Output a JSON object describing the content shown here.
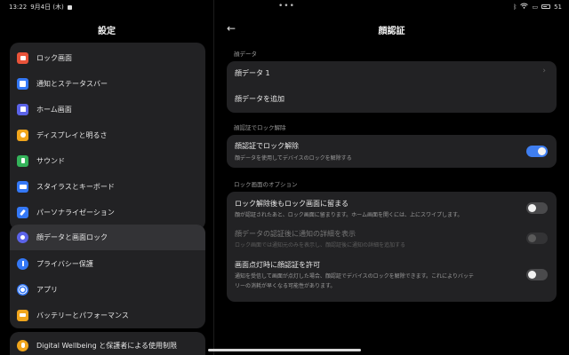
{
  "status_bar": {
    "time": "13:22",
    "date": "9月4日 (木)",
    "battery": "51"
  },
  "left_panel": {
    "title": "設定",
    "group1": [
      {
        "label": "ロック画面",
        "icon": "lock-icon",
        "color": "#e8533a"
      },
      {
        "label": "通知とステータスバー",
        "icon": "notification-icon",
        "color": "#3478f6"
      },
      {
        "label": "ホーム画面",
        "icon": "home-icon",
        "color": "#5b63e8"
      },
      {
        "label": "ディスプレイと明るさ",
        "icon": "brightness-icon",
        "color": "#f0a51c"
      },
      {
        "label": "サウンド",
        "icon": "sound-icon",
        "color": "#34b35a"
      },
      {
        "label": "スタイラスとキーボード",
        "icon": "keyboard-icon",
        "color": "#3478f6"
      },
      {
        "label": "パーソナライゼーション",
        "icon": "brush-icon",
        "color": "#3478f6"
      }
    ],
    "group2": [
      {
        "label": "顔データと画面ロック",
        "icon": "face-lock-icon",
        "color": "#5b63e8",
        "active": true
      },
      {
        "label": "プライバシー保護",
        "icon": "privacy-icon",
        "color": "#3478f6"
      },
      {
        "label": "アプリ",
        "icon": "apps-gear-icon",
        "color": "#3478f6"
      },
      {
        "label": "バッテリーとパフォーマンス",
        "icon": "battery-icon",
        "color": "#f0a51c"
      }
    ],
    "group3": [
      {
        "label": "Digital Wellbeing と保護者による使用制限",
        "icon": "wellbeing-icon",
        "color": "#f0a51c"
      }
    ]
  },
  "right_panel": {
    "title": "顔認証",
    "section_face_data": "顔データ",
    "face_data_1": "顔データ 1",
    "add_face_data": "顔データを追加",
    "section_unlock": "顔認証でロック解除",
    "unlock_title": "顔認証でロック解除",
    "unlock_sub": "顔データを使用してデバイスのロックを解除する",
    "unlock_on": true,
    "section_lock_options": "ロック画面のオプション",
    "stay_title": "ロック解除後もロック画面に留まる",
    "stay_sub": "顔が認証されたあと、ロック画面に留まります。ホーム画面を開くには、上にスワイプします。",
    "stay_on": false,
    "details_title": "顔データの認証後に通知の詳細を表示",
    "details_sub": "ロック画面では通知元のみを表示し、顔認証後に通知の詳細を追加する",
    "details_on": false,
    "screen_on_title": "画面点灯時に顔認証を許可",
    "screen_on_sub1": "通知を受信して画面が点灯した場合、顔認証でデバイスのロックを解除できます。これによりバッテ",
    "screen_on_sub2": "リーの消耗が早くなる可能性があります。",
    "screen_on_on": false
  }
}
